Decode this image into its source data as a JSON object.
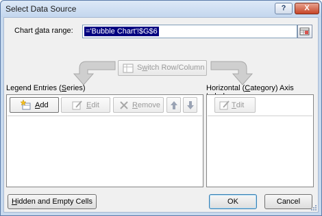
{
  "window": {
    "title": "Select Data Source",
    "help_glyph": "?",
    "close_glyph": "X"
  },
  "chart_range": {
    "label_prefix": "Chart ",
    "label_underlined": "d",
    "label_suffix": "ata range:",
    "value": "='Bubble Chart'!$G$6"
  },
  "switch_button": {
    "label_prefix": "S",
    "label_underlined": "w",
    "label_suffix": "itch Row/Column",
    "enabled": false
  },
  "legend_section": {
    "label_prefix": "Legend Entries (",
    "label_underlined": "S",
    "label_suffix": "eries)",
    "buttons": {
      "add": {
        "label_underlined": "A",
        "label_suffix": "dd",
        "enabled": true
      },
      "edit": {
        "label_underlined": "E",
        "label_suffix": "dit",
        "enabled": false
      },
      "remove": {
        "label_underlined": "R",
        "label_suffix": "emove",
        "enabled": false
      },
      "move_up": {
        "enabled": false
      },
      "move_down": {
        "enabled": false
      }
    },
    "series": []
  },
  "axis_section": {
    "label_prefix": "Horizontal (",
    "label_underlined": "C",
    "label_suffix": "ategory) Axis Labels",
    "buttons": {
      "edit": {
        "label_underlined": "T",
        "label_suffix": "dit",
        "enabled": false
      }
    },
    "labels": []
  },
  "footer": {
    "hidden_cells": {
      "label_underlined": "H",
      "label_suffix": "idden and Empty Cells"
    },
    "ok": "OK",
    "cancel": "Cancel"
  }
}
